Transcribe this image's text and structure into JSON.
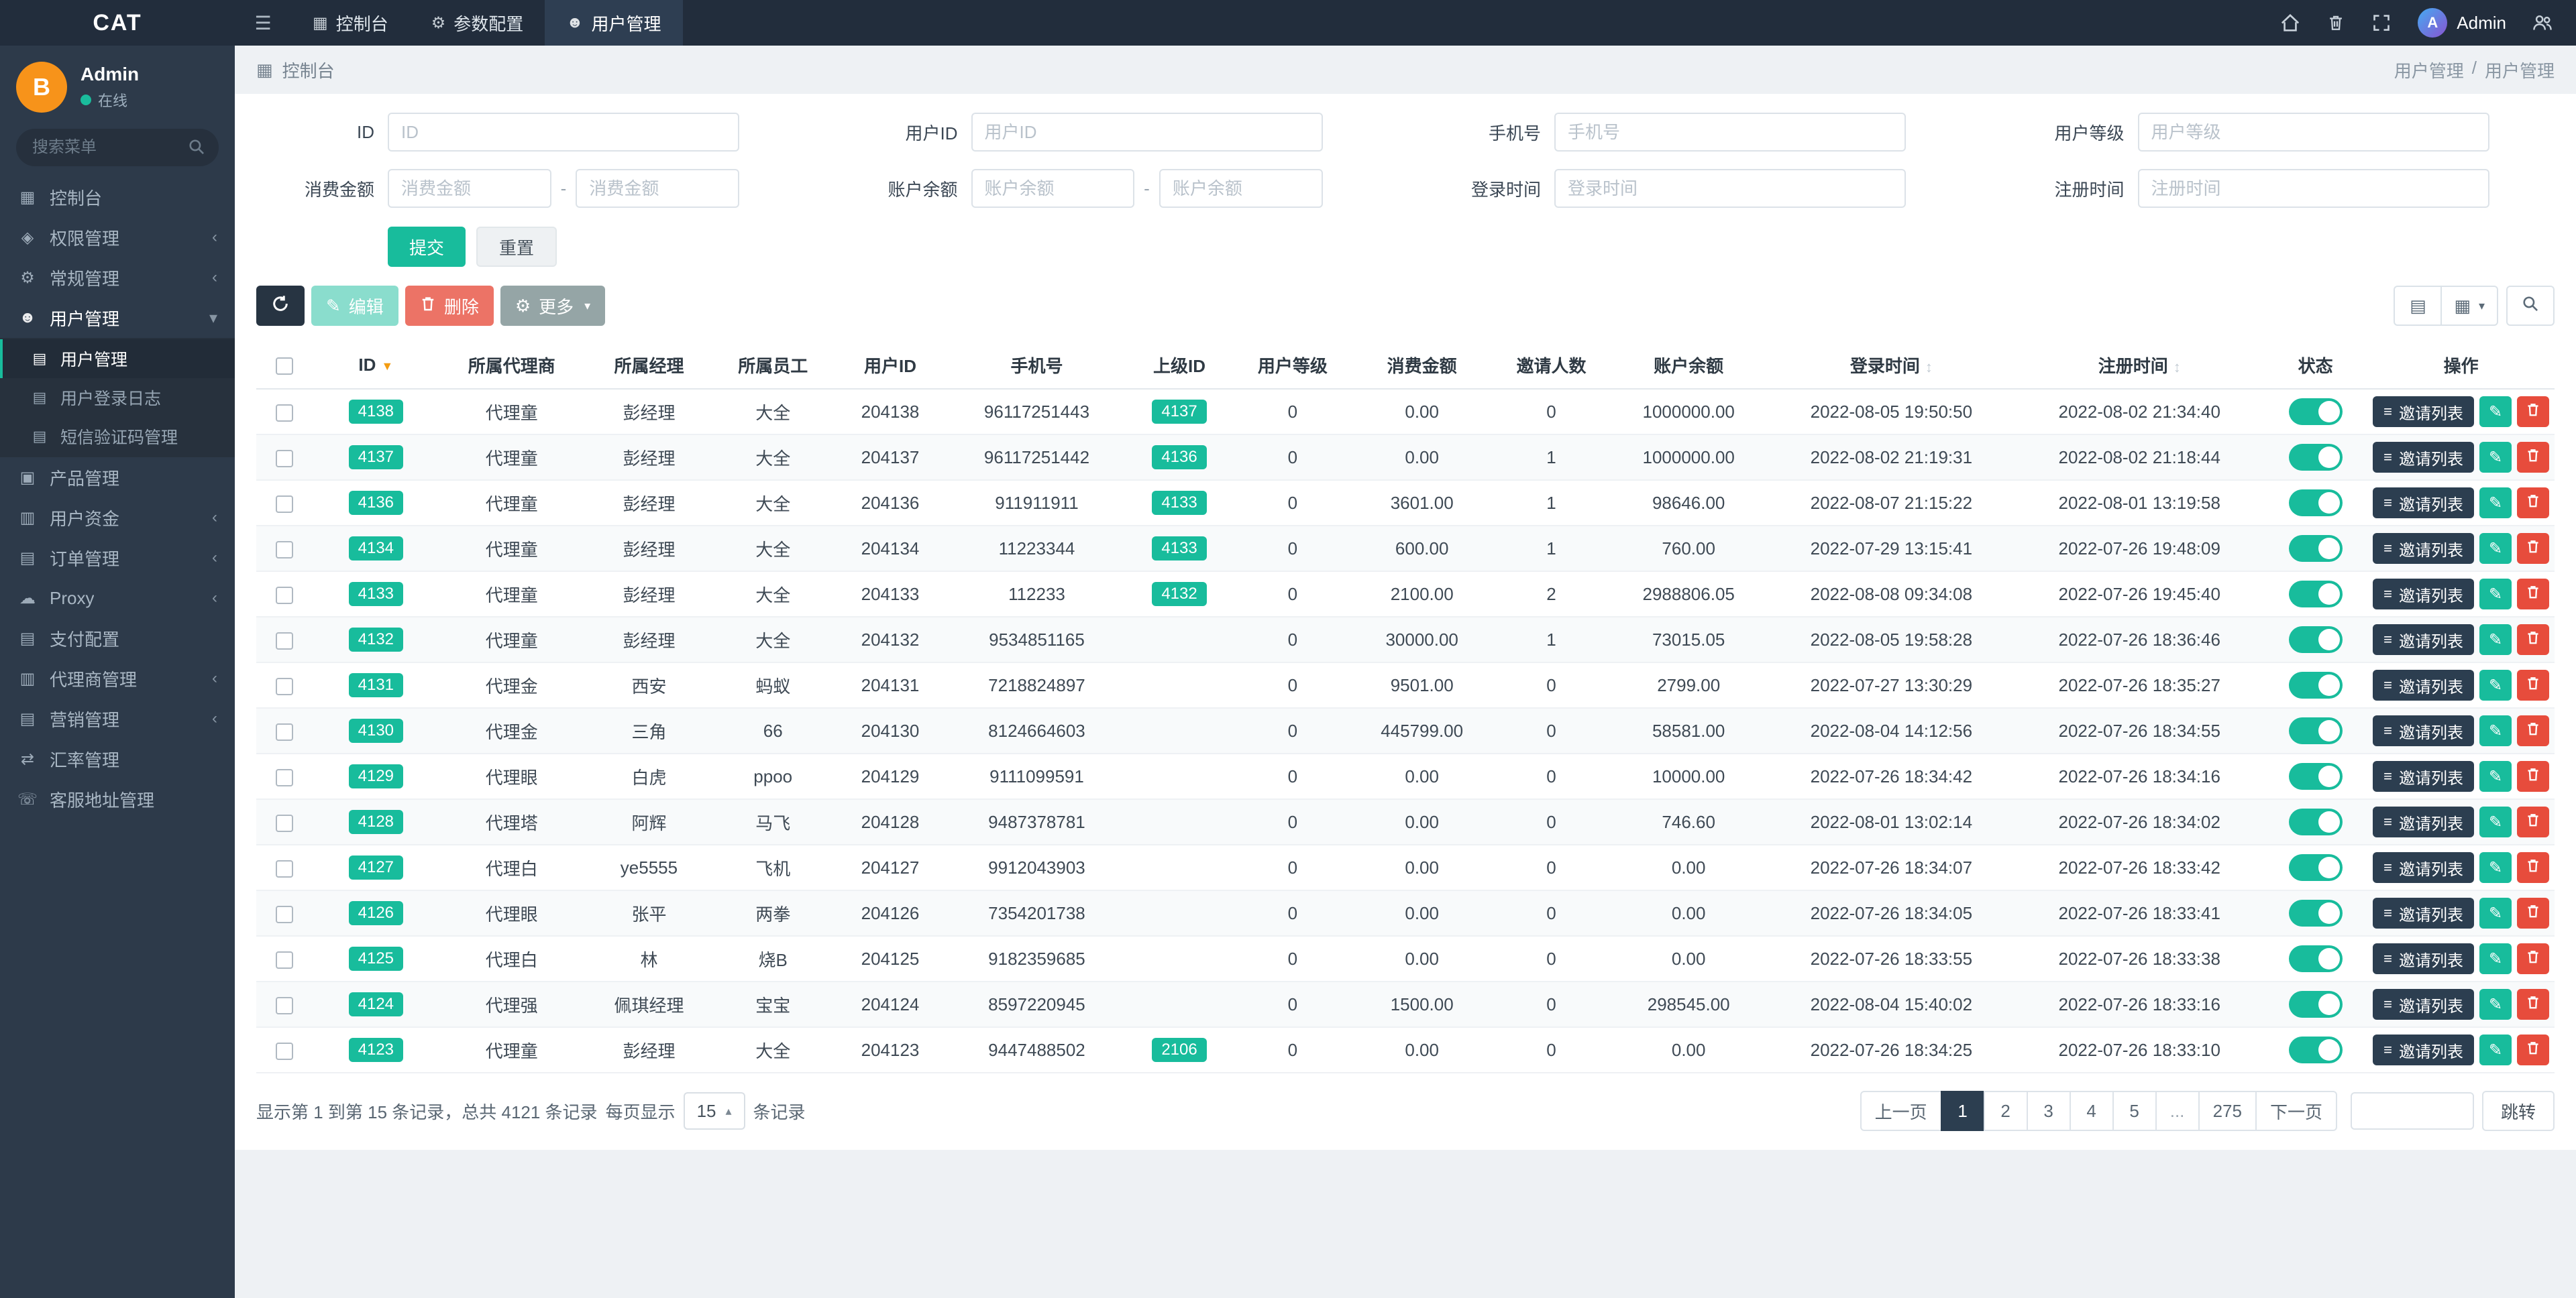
{
  "navbar": {
    "brand": "CAT",
    "items": [
      {
        "name": "console",
        "label": "控制台",
        "icon": "dashboard",
        "active": false
      },
      {
        "name": "params",
        "label": "参数配置",
        "icon": "gear",
        "active": false
      },
      {
        "name": "users",
        "label": "用户管理",
        "icon": "user",
        "active": true
      }
    ],
    "right": {
      "username": "Admin"
    }
  },
  "sidebar": {
    "user": {
      "name": "Admin",
      "status": "在线"
    },
    "search_placeholder": "搜索菜单",
    "menu": [
      {
        "name": "console",
        "label": "控制台",
        "icon": "dashboard"
      },
      {
        "name": "permissions",
        "label": "权限管理",
        "icon": "shield",
        "expandable": true
      },
      {
        "name": "general",
        "label": "常规管理",
        "icon": "gear",
        "expandable": true
      },
      {
        "name": "users",
        "label": "用户管理",
        "icon": "user",
        "expandable": true,
        "open": true,
        "children": [
          {
            "name": "user-list",
            "label": "用户管理",
            "active": true
          },
          {
            "name": "login-logs",
            "label": "用户登录日志"
          },
          {
            "name": "sms-codes",
            "label": "短信验证码管理"
          }
        ]
      },
      {
        "name": "products",
        "label": "产品管理",
        "icon": "product"
      },
      {
        "name": "user-funds",
        "label": "用户资金",
        "icon": "funds",
        "expandable": true
      },
      {
        "name": "orders",
        "label": "订单管理",
        "icon": "orders",
        "expandable": true
      },
      {
        "name": "proxy",
        "label": "Proxy",
        "icon": "cloud",
        "expandable": true
      },
      {
        "name": "payment-config",
        "label": "支付配置",
        "icon": "payment"
      },
      {
        "name": "agents",
        "label": "代理商管理",
        "icon": "agents",
        "expandable": true
      },
      {
        "name": "marketing",
        "label": "营销管理",
        "icon": "marketing",
        "expandable": true
      },
      {
        "name": "exchange-rates",
        "label": "汇率管理",
        "icon": "exchange"
      },
      {
        "name": "service-address",
        "label": "客服地址管理",
        "icon": "service"
      }
    ]
  },
  "breadcrumb": {
    "left": "控制台",
    "parent": "用户管理",
    "current": "用户管理"
  },
  "filter": {
    "rows": [
      [
        {
          "name": "id",
          "label": "ID",
          "type": "text",
          "placeholder": "ID"
        },
        {
          "name": "user-id",
          "label": "用户ID",
          "type": "text",
          "placeholder": "用户ID"
        },
        {
          "name": "phone",
          "label": "手机号",
          "type": "text",
          "placeholder": "手机号"
        },
        {
          "name": "user-level",
          "label": "用户等级",
          "type": "text",
          "placeholder": "用户等级"
        }
      ],
      [
        {
          "name": "consume-amount",
          "label": "消费金额",
          "type": "range",
          "placeholder": "消费金额"
        },
        {
          "name": "account-balance",
          "label": "账户余额",
          "type": "range",
          "placeholder": "账户余额"
        },
        {
          "name": "login-time",
          "label": "登录时间",
          "type": "text",
          "placeholder": "登录时间"
        },
        {
          "name": "register-time",
          "label": "注册时间",
          "type": "text",
          "placeholder": "注册时间"
        }
      ]
    ],
    "submit_label": "提交",
    "reset_label": "重置"
  },
  "toolbar": {
    "edit_label": "编辑",
    "delete_label": "删除",
    "more_label": "更多"
  },
  "table": {
    "columns": [
      {
        "key": "id",
        "label": "ID",
        "sorted": "desc"
      },
      {
        "key": "agent",
        "label": "所属代理商"
      },
      {
        "key": "manager",
        "label": "所属经理"
      },
      {
        "key": "staff",
        "label": "所属员工"
      },
      {
        "key": "user_id",
        "label": "用户ID"
      },
      {
        "key": "phone",
        "label": "手机号"
      },
      {
        "key": "parent_id",
        "label": "上级ID"
      },
      {
        "key": "level",
        "label": "用户等级"
      },
      {
        "key": "consume",
        "label": "消费金额"
      },
      {
        "key": "invites",
        "label": "邀请人数"
      },
      {
        "key": "balance",
        "label": "账户余额"
      },
      {
        "key": "login_time",
        "label": "登录时间",
        "sortable": true
      },
      {
        "key": "register_time",
        "label": "注册时间",
        "sortable": true
      },
      {
        "key": "status",
        "label": "状态"
      },
      {
        "key": "ops",
        "label": "操作"
      }
    ],
    "ops": {
      "invite_label": "邀请列表"
    },
    "rows": [
      {
        "id": "4138",
        "agent": "代理童",
        "manager": "彭经理",
        "staff": "大全",
        "user_id": "204138",
        "phone": "96117251443",
        "parent_id": "4137",
        "level": "0",
        "consume": "0.00",
        "invites": "0",
        "balance": "1000000.00",
        "login_time": "2022-08-05 19:50:50",
        "register_time": "2022-08-02 21:34:40",
        "status_on": true
      },
      {
        "id": "4137",
        "agent": "代理童",
        "manager": "彭经理",
        "staff": "大全",
        "user_id": "204137",
        "phone": "96117251442",
        "parent_id": "4136",
        "level": "0",
        "consume": "0.00",
        "invites": "1",
        "balance": "1000000.00",
        "login_time": "2022-08-02 21:19:31",
        "register_time": "2022-08-02 21:18:44",
        "status_on": true
      },
      {
        "id": "4136",
        "agent": "代理童",
        "manager": "彭经理",
        "staff": "大全",
        "user_id": "204136",
        "phone": "911911911",
        "parent_id": "4133",
        "level": "0",
        "consume": "3601.00",
        "invites": "1",
        "balance": "98646.00",
        "login_time": "2022-08-07 21:15:22",
        "register_time": "2022-08-01 13:19:58",
        "status_on": true
      },
      {
        "id": "4134",
        "agent": "代理童",
        "manager": "彭经理",
        "staff": "大全",
        "user_id": "204134",
        "phone": "11223344",
        "parent_id": "4133",
        "level": "0",
        "consume": "600.00",
        "invites": "1",
        "balance": "760.00",
        "login_time": "2022-07-29 13:15:41",
        "register_time": "2022-07-26 19:48:09",
        "status_on": true
      },
      {
        "id": "4133",
        "agent": "代理童",
        "manager": "彭经理",
        "staff": "大全",
        "user_id": "204133",
        "phone": "112233",
        "parent_id": "4132",
        "level": "0",
        "consume": "2100.00",
        "invites": "2",
        "balance": "2988806.05",
        "login_time": "2022-08-08 09:34:08",
        "register_time": "2022-07-26 19:45:40",
        "status_on": true
      },
      {
        "id": "4132",
        "agent": "代理童",
        "manager": "彭经理",
        "staff": "大全",
        "user_id": "204132",
        "phone": "9534851165",
        "parent_id": "",
        "level": "0",
        "consume": "30000.00",
        "invites": "1",
        "balance": "73015.05",
        "login_time": "2022-08-05 19:58:28",
        "register_time": "2022-07-26 18:36:46",
        "status_on": true
      },
      {
        "id": "4131",
        "agent": "代理金",
        "manager": "西安",
        "staff": "蚂蚁",
        "user_id": "204131",
        "phone": "7218824897",
        "parent_id": "",
        "level": "0",
        "consume": "9501.00",
        "invites": "0",
        "balance": "2799.00",
        "login_time": "2022-07-27 13:30:29",
        "register_time": "2022-07-26 18:35:27",
        "status_on": true
      },
      {
        "id": "4130",
        "agent": "代理金",
        "manager": "三角",
        "staff": "66",
        "user_id": "204130",
        "phone": "8124664603",
        "parent_id": "",
        "level": "0",
        "consume": "445799.00",
        "invites": "0",
        "balance": "58581.00",
        "login_time": "2022-08-04 14:12:56",
        "register_time": "2022-07-26 18:34:55",
        "status_on": true
      },
      {
        "id": "4129",
        "agent": "代理眼",
        "manager": "白虎",
        "staff": "ppoo",
        "user_id": "204129",
        "phone": "9111099591",
        "parent_id": "",
        "level": "0",
        "consume": "0.00",
        "invites": "0",
        "balance": "10000.00",
        "login_time": "2022-07-26 18:34:42",
        "register_time": "2022-07-26 18:34:16",
        "status_on": true
      },
      {
        "id": "4128",
        "agent": "代理塔",
        "manager": "阿辉",
        "staff": "马飞",
        "user_id": "204128",
        "phone": "9487378781",
        "parent_id": "",
        "level": "0",
        "consume": "0.00",
        "invites": "0",
        "balance": "746.60",
        "login_time": "2022-08-01 13:02:14",
        "register_time": "2022-07-26 18:34:02",
        "status_on": true
      },
      {
        "id": "4127",
        "agent": "代理白",
        "manager": "ye5555",
        "staff": "飞机",
        "user_id": "204127",
        "phone": "9912043903",
        "parent_id": "",
        "level": "0",
        "consume": "0.00",
        "invites": "0",
        "balance": "0.00",
        "login_time": "2022-07-26 18:34:07",
        "register_time": "2022-07-26 18:33:42",
        "status_on": true
      },
      {
        "id": "4126",
        "agent": "代理眼",
        "manager": "张平",
        "staff": "两拳",
        "user_id": "204126",
        "phone": "7354201738",
        "parent_id": "",
        "level": "0",
        "consume": "0.00",
        "invites": "0",
        "balance": "0.00",
        "login_time": "2022-07-26 18:34:05",
        "register_time": "2022-07-26 18:33:41",
        "status_on": true
      },
      {
        "id": "4125",
        "agent": "代理白",
        "manager": "林",
        "staff": "烧B",
        "user_id": "204125",
        "phone": "9182359685",
        "parent_id": "",
        "level": "0",
        "consume": "0.00",
        "invites": "0",
        "balance": "0.00",
        "login_time": "2022-07-26 18:33:55",
        "register_time": "2022-07-26 18:33:38",
        "status_on": true
      },
      {
        "id": "4124",
        "agent": "代理强",
        "manager": "佩琪经理",
        "staff": "宝宝",
        "user_id": "204124",
        "phone": "8597220945",
        "parent_id": "",
        "level": "0",
        "consume": "1500.00",
        "invites": "0",
        "balance": "298545.00",
        "login_time": "2022-08-04 15:40:02",
        "register_time": "2022-07-26 18:33:16",
        "status_on": true
      },
      {
        "id": "4123",
        "agent": "代理童",
        "manager": "彭经理",
        "staff": "大全",
        "user_id": "204123",
        "phone": "9447488502",
        "parent_id": "2106",
        "level": "0",
        "consume": "0.00",
        "invites": "0",
        "balance": "0.00",
        "login_time": "2022-07-26 18:34:25",
        "register_time": "2022-07-26 18:33:10",
        "status_on": true
      }
    ]
  },
  "pagination": {
    "summary": "显示第 1 到第 15 条记录，总共 4121 条记录",
    "per_page_label": "每页显示",
    "page_size": "15",
    "per_page_suffix": "条记录",
    "pages": [
      "上一页",
      "1",
      "2",
      "3",
      "4",
      "5",
      "...",
      "275",
      "下一页"
    ],
    "active_page": "1",
    "jump_label": "跳转"
  }
}
